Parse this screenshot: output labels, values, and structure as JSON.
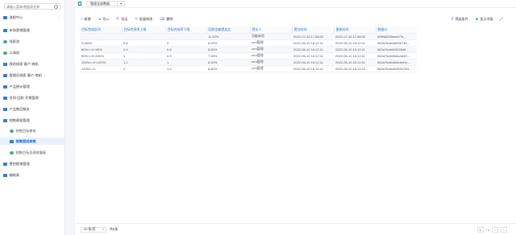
{
  "sidebar": {
    "search_placeholder": "请输入菜单/数据表名称",
    "items": [
      {
        "label": "流程中心",
        "type": "folder"
      },
      {
        "label": "市场营销管理",
        "type": "folder"
      },
      {
        "label": "线索池",
        "type": "green"
      },
      {
        "label": "公海池",
        "type": "green"
      },
      {
        "label": "我的线索·客户·商机",
        "type": "folder"
      },
      {
        "label": "管理员线索·客户·商机",
        "type": "folder"
      },
      {
        "label": "产品统计管理",
        "type": "folder"
      },
      {
        "label": "合同·回款·开票管理",
        "type": "folder"
      },
      {
        "label": "产品售后服务",
        "type": "folder"
      },
      {
        "label": "销售绩效管理",
        "type": "folder"
      },
      {
        "label": "销售目标审核",
        "type": "green"
      },
      {
        "label": "销售提成参数",
        "type": "green"
      },
      {
        "label": "销售目标及绩效看板",
        "type": "green"
      },
      {
        "label": "费控报销管理",
        "type": "folder"
      },
      {
        "label": "辅助表",
        "type": "folder"
      }
    ]
  },
  "topbar": {
    "view": "管理全部数据"
  },
  "toolbar": {
    "new": "新建",
    "import": "导入",
    "export": "导出",
    "batch_edit": "批量修改",
    "delete": "删除",
    "filter": "筛选条件",
    "display": "显示字段"
  },
  "table": {
    "headers": [
      "目标完成区间",
      "目标完成率上限",
      "目标完成率下限",
      "回款金额提成比",
      "提交人",
      "提交时间",
      "更新时间",
      "数据ID"
    ],
    "rows": [
      [
        "",
        "",
        "",
        "11.00%",
        "功能体验",
        "2022-07-19 17:58:02",
        "2022-07-19 17:58:02",
        "50ff9820f5eea07b..."
      ],
      [
        "X<80%",
        "0.8",
        "0",
        "6.00%",
        "crm管理",
        "2022-06-10 16:12:11",
        "2022-06-10 16:12:11",
        "562a7fcdb4605e74f1..."
      ],
      [
        "80%<=X<90%",
        "0.9",
        "0.8",
        "6.50%",
        "crm管理",
        "2022-06-10 16:12:11",
        "2022-06-10 16:12:11",
        "562a7fcdbf19026d5..."
      ],
      [
        "90%<=X<100%",
        "1",
        "0.9",
        "7.00%",
        "crm管理",
        "2022-06-10 16:12:11",
        "2022-06-10 16:12:11",
        "562a7fcdb5b8a4d4f1..."
      ],
      [
        "100%<=X<120%",
        "1.2",
        "1",
        "8.00%",
        "crm管理",
        "2022-06-10 16:12:11",
        "2022-06-10 16:12:11",
        "562a7fcdb4b5e6ef1e..."
      ],
      [
        "120%<=X",
        "2",
        "1.2",
        "8.50%",
        "crm管理",
        "2022-06-10 16:12:11",
        "2022-06-10 16:12:12",
        "562a7fcdb4e952e74f1..."
      ]
    ]
  },
  "footer": {
    "page_size": "20 条/页",
    "total": "共6条",
    "page_current": "1",
    "page_total": "/ 1"
  }
}
